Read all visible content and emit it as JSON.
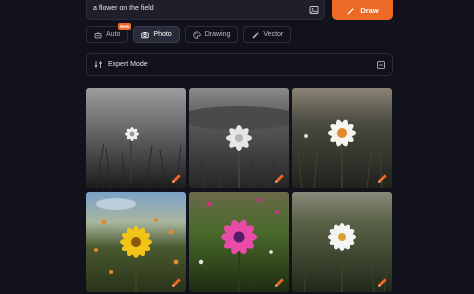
{
  "prompt": {
    "value": "a flower on the field"
  },
  "actions": {
    "draw_label": "Draw"
  },
  "tabs": [
    {
      "label": "Auto",
      "badge": "New",
      "icon": "robot-icon",
      "active": false
    },
    {
      "label": "Photo",
      "icon": "camera-icon",
      "active": true
    },
    {
      "label": "Drawing",
      "icon": "palette-icon",
      "active": false
    },
    {
      "label": "Vector",
      "icon": "pen-tool-icon",
      "active": false
    }
  ],
  "expert": {
    "label": "Expert Mode"
  },
  "images": [
    {
      "subject": "daisy-bw-field"
    },
    {
      "subject": "daisy-bw-closeup"
    },
    {
      "subject": "daisy-white-sepia"
    },
    {
      "subject": "yellow-flower-sky"
    },
    {
      "subject": "pink-flower-field"
    },
    {
      "subject": "white-daisy-field"
    }
  ],
  "colors": {
    "accent": "#ec6a26",
    "background": "#12121c",
    "panel": "#1e1f2b"
  }
}
